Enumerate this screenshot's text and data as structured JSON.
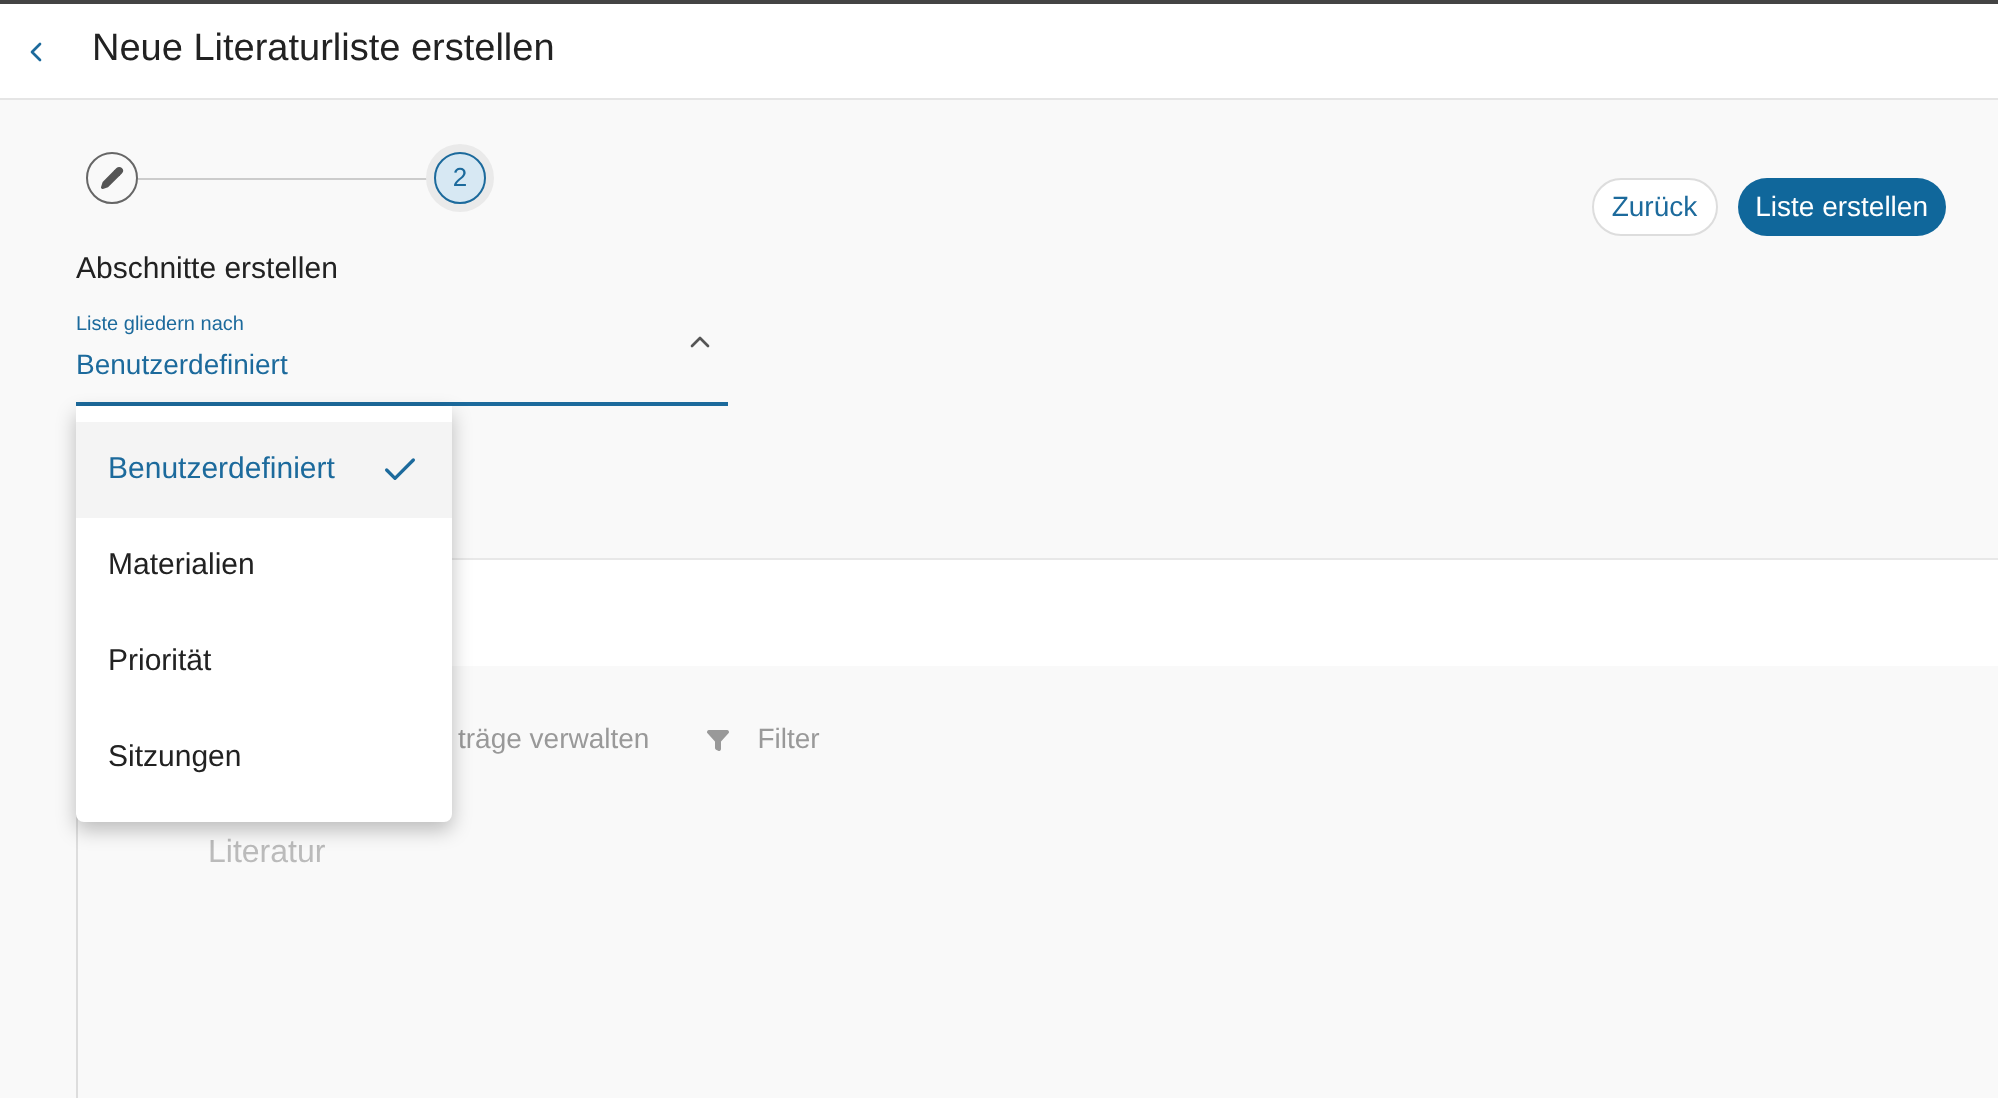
{
  "header": {
    "title": "Neue Literaturliste erstellen"
  },
  "stepper": {
    "steps": [
      {
        "kind": "edit",
        "selected": false
      },
      {
        "kind": "number",
        "label": "2",
        "selected": true
      }
    ]
  },
  "actions": [
    {
      "label": "Zurück",
      "kind": "secondary"
    },
    {
      "label": "Liste erstellen",
      "kind": "primary"
    }
  ],
  "section_title": "Abschnitte erstellen",
  "select": {
    "label": "Liste gliedern nach",
    "value": "Benutzerdefiniert",
    "expanded": true,
    "options": [
      {
        "label": "Benutzerdefiniert",
        "selected": true
      },
      {
        "label": "Materialien",
        "selected": false
      },
      {
        "label": "Priorität",
        "selected": false
      },
      {
        "label": "Sitzungen",
        "selected": false
      }
    ]
  },
  "toolbar": [
    {
      "label": "träge verwalten",
      "kind": "text"
    },
    {
      "label": "Filter",
      "kind": "filter"
    }
  ],
  "list_heading": "Literatur"
}
